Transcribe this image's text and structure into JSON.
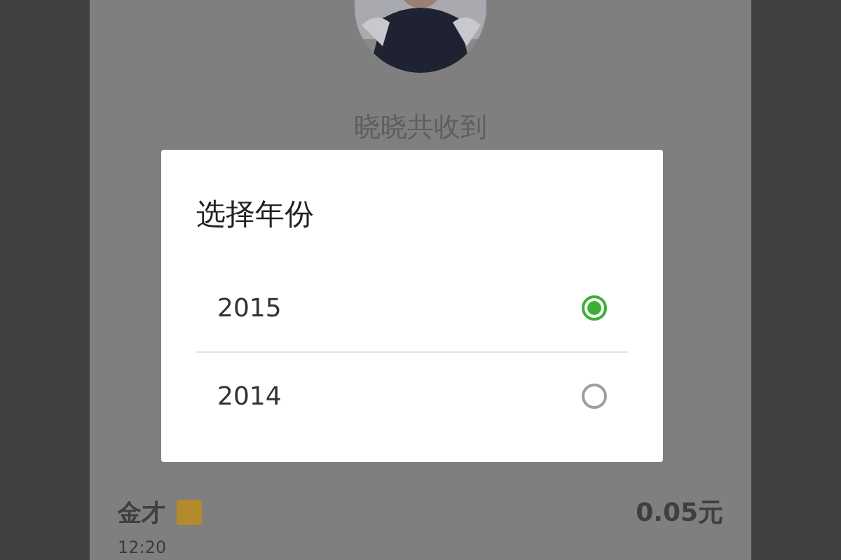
{
  "background": {
    "caption": "晓晓共收到",
    "record": {
      "name": "金才",
      "amount": "0.05元",
      "time": "12:20"
    }
  },
  "dialog": {
    "title": "选择年份",
    "options": [
      {
        "label": "2015",
        "selected": true
      },
      {
        "label": "2014",
        "selected": false
      }
    ]
  }
}
